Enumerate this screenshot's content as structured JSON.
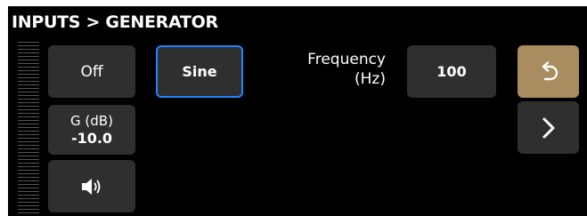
{
  "header": {
    "title": "INPUTS > GENERATOR"
  },
  "left_column": {
    "power_label": "Off",
    "gain_label": "G (dB)",
    "gain_value": "-10.0",
    "speaker_icon": "speaker-icon"
  },
  "waveform": {
    "selected_label": "Sine"
  },
  "frequency": {
    "label_line1": "Frequency",
    "label_line2": "(Hz)",
    "value": "100"
  },
  "nav": {
    "back_icon": "undo-arrow-icon",
    "next_icon": "chevron-right-icon"
  },
  "colors": {
    "background": "#000000",
    "button": "#2f2f2f",
    "accent_selected_border": "#1f86ff",
    "back_button": "#a98d61",
    "text": "#ffffff"
  }
}
